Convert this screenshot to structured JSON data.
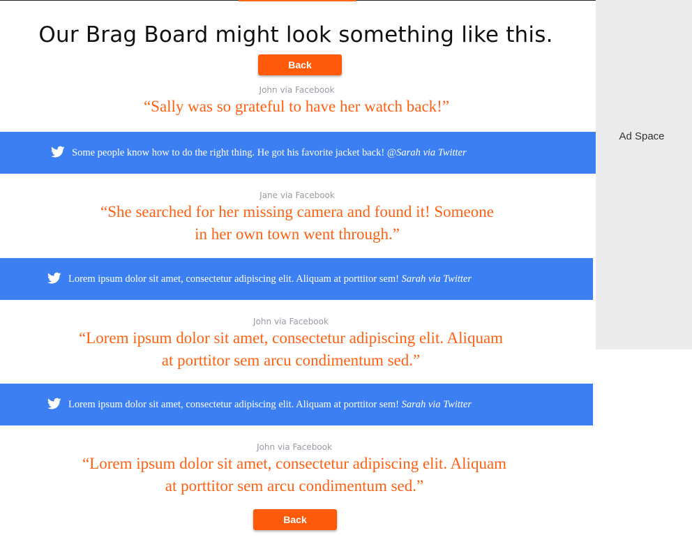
{
  "nav": {
    "segments": [
      "",
      "",
      "",
      "",
      ""
    ],
    "active_index": 2
  },
  "page": {
    "title": "Our Brag Board might look something like this."
  },
  "buttons": {
    "back_top": "Back",
    "back_bottom": "Back"
  },
  "facebook_posts": [
    {
      "source": "John via Facebook",
      "quote": "“Sally was so grateful to have her watch back!”"
    },
    {
      "source": "Jane via Facebook",
      "quote": "“She searched for her missing camera and found it! Someone in her own town went through.”"
    },
    {
      "source": "John via Facebook",
      "quote": "“Lorem ipsum dolor sit amet, consectetur adipiscing elit. Aliquam at porttitor sem arcu condimentum sed.”"
    },
    {
      "source": "John via Facebook",
      "quote": "“Lorem ipsum dolor sit amet, consectetur adipiscing elit. Aliquam at porttitor sem arcu condimentum sed.”"
    }
  ],
  "twitter_posts": [
    {
      "text": "Some people know how to do the right thing. He got his favorite jacket back! @",
      "author": "Sarah via Twitter",
      "icon": "twitter-bird-icon"
    },
    {
      "text": "Lorem ipsum dolor sit amet, consectetur adipiscing elit. Aliquam at porttitor sem! ",
      "author": "Sarah via Twitter",
      "icon": "twitter-bird-icon"
    },
    {
      "text": "Lorem ipsum dolor sit amet, consectetur adipiscing elit. Aliquam at porttitor sem! ",
      "author": "Sarah via Twitter",
      "icon": "twitter-bird-icon"
    }
  ],
  "ad": {
    "label": "Ad Space"
  },
  "colors": {
    "accent": "#ff6011",
    "twitter_blue": "#3b7ff2",
    "ad_background": "#ebebeb"
  }
}
